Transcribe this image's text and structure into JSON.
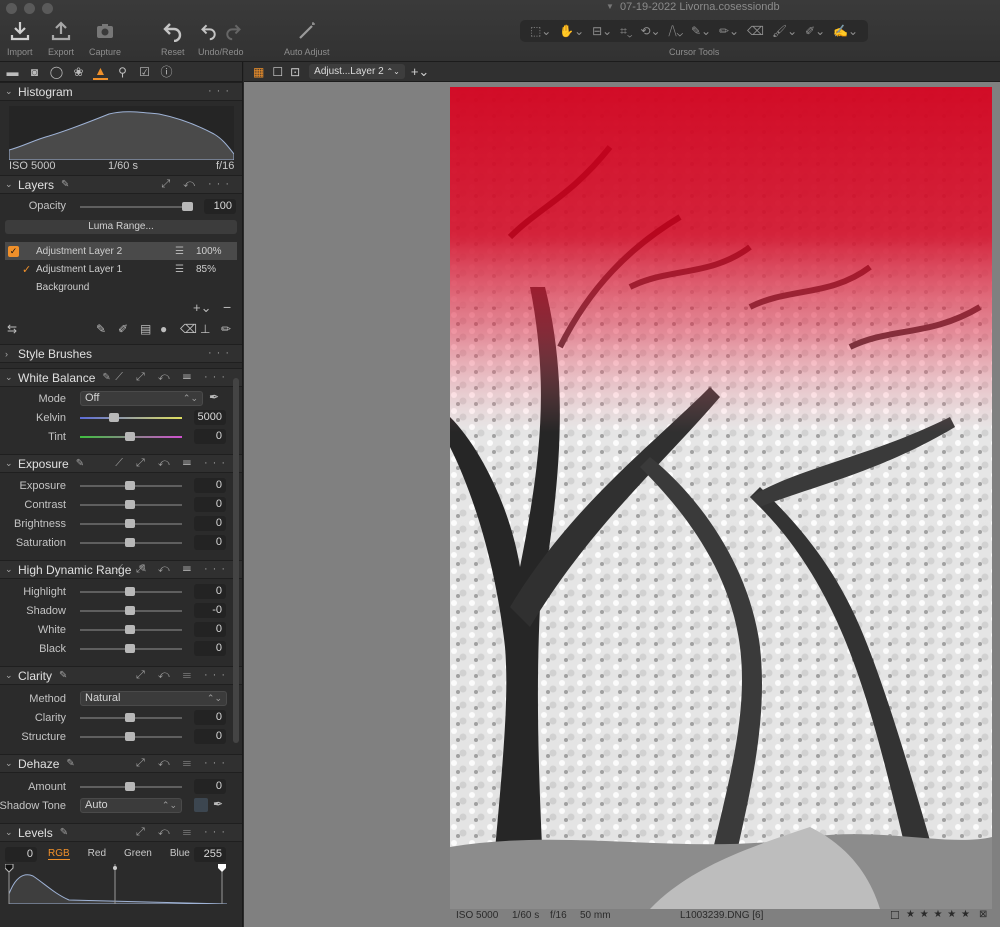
{
  "window": {
    "title": "07-19-2022 Livorna.cosessiondb"
  },
  "toolbar": {
    "import": "Import",
    "export": "Export",
    "capture": "Capture",
    "reset": "Reset",
    "undo_redo": "Undo/Redo",
    "auto_adjust": "Auto Adjust",
    "cursor_tools": "Cursor Tools"
  },
  "histogram": {
    "title": "Histogram",
    "iso": "ISO 5000",
    "shutter": "1/60 s",
    "aperture": "f/16"
  },
  "layers": {
    "title": "Layers",
    "opacity_label": "Opacity",
    "opacity_value": "100",
    "opacity_level": 1.0,
    "luma_button": "Luma Range...",
    "items": [
      {
        "name": "Adjustment Layer 2",
        "opacity": "100%"
      },
      {
        "name": "Adjustment Layer 1",
        "opacity": "85%"
      },
      {
        "name": "Background",
        "opacity": ""
      }
    ]
  },
  "style_brushes": {
    "title": "Style Brushes"
  },
  "white_balance": {
    "title": "White Balance",
    "mode_label": "Mode",
    "mode_value": "Off",
    "kelvin_label": "Kelvin",
    "kelvin_value": "5000",
    "tint_label": "Tint",
    "tint_value": "0"
  },
  "exposure": {
    "title": "Exposure",
    "rows": [
      {
        "label": "Exposure",
        "value": "0"
      },
      {
        "label": "Contrast",
        "value": "0"
      },
      {
        "label": "Brightness",
        "value": "0"
      },
      {
        "label": "Saturation",
        "value": "0"
      }
    ]
  },
  "hdr": {
    "title": "High Dynamic Range",
    "rows": [
      {
        "label": "Highlight",
        "value": "0"
      },
      {
        "label": "Shadow",
        "value": "-0"
      },
      {
        "label": "White",
        "value": "0"
      },
      {
        "label": "Black",
        "value": "0"
      }
    ]
  },
  "clarity": {
    "title": "Clarity",
    "method_label": "Method",
    "method_value": "Natural",
    "clarity_label": "Clarity",
    "clarity_value": "0",
    "structure_label": "Structure",
    "structure_value": "0"
  },
  "dehaze": {
    "title": "Dehaze",
    "amount_label": "Amount",
    "amount_value": "0",
    "shadow_label": "Shadow Tone",
    "shadow_value": "Auto"
  },
  "levels": {
    "title": "Levels",
    "low": "0",
    "high": "255",
    "channels": [
      "RGB",
      "Red",
      "Green",
      "Blue"
    ],
    "active_channel": "RGB"
  },
  "viewer": {
    "layer_select": "Adjust...Layer 2",
    "status": {
      "iso": "ISO 5000",
      "shutter": "1/60 s",
      "aperture": "f/16",
      "focal": "50 mm",
      "filename": "L1003239.DNG [6]",
      "rating": "★ ★ ★ ★ ★"
    }
  },
  "colors": {
    "accent": "#f0902a",
    "mask_red": "#d0001c"
  }
}
